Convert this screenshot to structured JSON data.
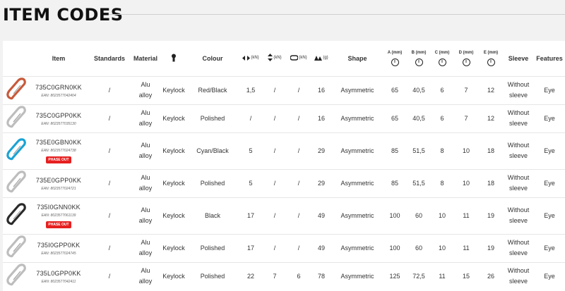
{
  "page": {
    "title": "ITEM CODES"
  },
  "headers": {
    "item": "Item",
    "standards": "Standards",
    "material": "Material",
    "gate_icon": "keylock-icon",
    "colour": "Colour",
    "major_axis": "(kN)",
    "minor_axis": "(kN)",
    "open_gate": "(kN)",
    "weight": "(g)",
    "shape": "Shape",
    "a": "A (mm)",
    "b": "B (mm)",
    "c": "C (mm)",
    "d": "D (mm)",
    "e": "E (mm)",
    "info_glyph": "i",
    "sleeve": "Sleeve",
    "features": "Features"
  },
  "rows": [
    {
      "code": "735C0GRN0KK",
      "ean": "EAN: 8023577042404",
      "phase_out": "",
      "image_color": "#c8593a",
      "standards": "/",
      "material_1": "Alu",
      "material_2": "alloy",
      "gate": "Keylock",
      "colour": "Red/Black",
      "major": "1,5",
      "minor": "/",
      "open": "/",
      "weight": "16",
      "shape": "Asymmetric",
      "a": "65",
      "b": "40,5",
      "c": "6",
      "d": "7",
      "e": "12",
      "sleeve_1": "Without",
      "sleeve_2": "sleeve",
      "features": "Eye"
    },
    {
      "code": "735C0GPP0KK",
      "ean": "EAN: 8023577035130",
      "phase_out": "",
      "image_color": "#bdbdbd",
      "standards": "/",
      "material_1": "Alu",
      "material_2": "alloy",
      "gate": "Keylock",
      "colour": "Polished",
      "major": "/",
      "minor": "/",
      "open": "/",
      "weight": "16",
      "shape": "Asymmetric",
      "a": "65",
      "b": "40,5",
      "c": "6",
      "d": "7",
      "e": "12",
      "sleeve_1": "Without",
      "sleeve_2": "sleeve",
      "features": "Eye"
    },
    {
      "code": "735E0GBN0KK",
      "ean": "EAN: 8023577024738",
      "phase_out": "PHASE OUT",
      "image_color": "#1aa3d4",
      "standards": "/",
      "material_1": "Alu",
      "material_2": "alloy",
      "gate": "Keylock",
      "colour": "Cyan/Black",
      "major": "5",
      "minor": "/",
      "open": "/",
      "weight": "29",
      "shape": "Asymmetric",
      "a": "85",
      "b": "51,5",
      "c": "8",
      "d": "10",
      "e": "18",
      "sleeve_1": "Without",
      "sleeve_2": "sleeve",
      "features": "Eye"
    },
    {
      "code": "735E0GPP0KK",
      "ean": "EAN: 8023577024721",
      "phase_out": "",
      "image_color": "#bdbdbd",
      "standards": "/",
      "material_1": "Alu",
      "material_2": "alloy",
      "gate": "Keylock",
      "colour": "Polished",
      "major": "5",
      "minor": "/",
      "open": "/",
      "weight": "29",
      "shape": "Asymmetric",
      "a": "85",
      "b": "51,5",
      "c": "8",
      "d": "10",
      "e": "18",
      "sleeve_1": "Without",
      "sleeve_2": "sleeve",
      "features": "Eye"
    },
    {
      "code": "735I0GNN0KK",
      "ean": "EAN: 8023577061139",
      "phase_out": "PHASE OUT",
      "image_color": "#2a2a2a",
      "standards": "/",
      "material_1": "Alu",
      "material_2": "alloy",
      "gate": "Keylock",
      "colour": "Black",
      "major": "17",
      "minor": "/",
      "open": "/",
      "weight": "49",
      "shape": "Asymmetric",
      "a": "100",
      "b": "60",
      "c": "10",
      "d": "11",
      "e": "19",
      "sleeve_1": "Without",
      "sleeve_2": "sleeve",
      "features": "Eye"
    },
    {
      "code": "735I0GPP0KK",
      "ean": "EAN: 8023577024745",
      "phase_out": "",
      "image_color": "#bdbdbd",
      "standards": "/",
      "material_1": "Alu",
      "material_2": "alloy",
      "gate": "Keylock",
      "colour": "Polished",
      "major": "17",
      "minor": "/",
      "open": "/",
      "weight": "49",
      "shape": "Asymmetric",
      "a": "100",
      "b": "60",
      "c": "10",
      "d": "11",
      "e": "19",
      "sleeve_1": "Without",
      "sleeve_2": "sleeve",
      "features": "Eye"
    },
    {
      "code": "735L0GPP0KK",
      "ean": "EAN: 8023577042411",
      "phase_out": "",
      "image_color": "#bdbdbd",
      "standards": "/",
      "material_1": "Alu",
      "material_2": "alloy",
      "gate": "Keylock",
      "colour": "Polished",
      "major": "22",
      "minor": "7",
      "open": "6",
      "weight": "78",
      "shape": "Asymmetric",
      "a": "125",
      "b": "72,5",
      "c": "11",
      "d": "15",
      "e": "26",
      "sleeve_1": "Without",
      "sleeve_2": "sleeve",
      "features": "Eye"
    }
  ]
}
